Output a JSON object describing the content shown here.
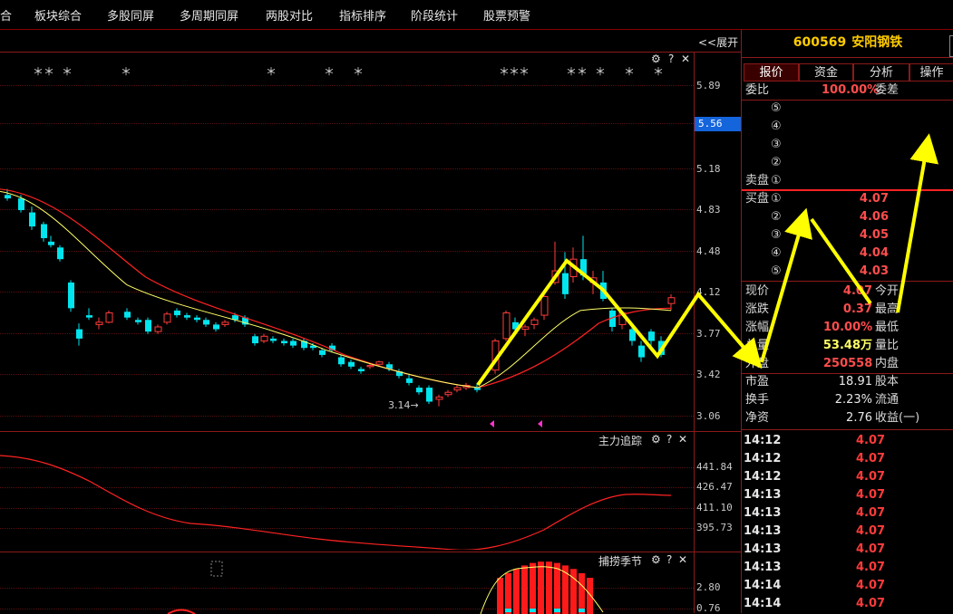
{
  "menu": {
    "items": [
      "合",
      "板块综合",
      "多股同屏",
      "多周期同屏",
      "两股对比",
      "指标排序",
      "阶段统计",
      "股票预警"
    ]
  },
  "chart": {
    "expand_label": "<<展开",
    "price_axis": [
      "5.89",
      "5.56",
      "5.18",
      "4.83",
      "4.48",
      "4.12",
      "3.77",
      "3.42",
      "3.06"
    ],
    "current_price_tag": "5.56",
    "low_annotation": "3.14",
    "gear_icon": "⚙",
    "help_icon": "?",
    "close_icon": "✕",
    "star_glyph": "＊",
    "indicator1": {
      "title": "主力追踪",
      "axis": [
        "441.84",
        "426.47",
        "411.10",
        "395.73"
      ]
    },
    "indicator2": {
      "title": "捕捞季节",
      "axis": [
        "2.80",
        "0.76"
      ]
    },
    "colors": {
      "up": "#ff3b3b",
      "down": "#00e5ee",
      "ma_yellow": "#ffff66",
      "ma_red": "#ff2222",
      "arrow": "#ffff00",
      "price_tag_bg": "#1464dc"
    }
  },
  "quote": {
    "code": "600569",
    "name": "安阳钢铁",
    "tabs": [
      "报价",
      "资金",
      "分析",
      "操作"
    ],
    "weibi_label": "委比",
    "weibi_value": "100.00%",
    "weicha_label": "委差",
    "sell_levels": [
      "⑤",
      "④",
      "③",
      "②",
      "①"
    ],
    "sell_label": "卖盘",
    "buy_label": "买盘",
    "buy_levels": [
      {
        "level": "①",
        "price": "4.07"
      },
      {
        "level": "②",
        "price": "4.06"
      },
      {
        "level": "③",
        "price": "4.05"
      },
      {
        "level": "④",
        "price": "4.04"
      },
      {
        "level": "⑤",
        "price": "4.03"
      }
    ],
    "stats": [
      {
        "l1": "现价",
        "v1": "4.07",
        "l2": "今开"
      },
      {
        "l1": "涨跌",
        "v1": "0.37",
        "l2": "最高"
      },
      {
        "l1": "涨幅",
        "v1": "10.00%",
        "l2": "最低"
      },
      {
        "l1": "总量",
        "v1": "53.48万",
        "l2": "量比"
      },
      {
        "l1": "外盘",
        "v1": "250558",
        "l2": "内盘"
      }
    ],
    "fundamentals": [
      {
        "l1": "市盈",
        "v1": "18.91",
        "l2": "股本"
      },
      {
        "l1": "换手",
        "v1": "2.23%",
        "l2": "流通"
      },
      {
        "l1": "净资",
        "v1": "2.76",
        "l2": "收益(一)"
      }
    ],
    "ticks": [
      {
        "time": "14:12",
        "price": "4.07"
      },
      {
        "time": "14:12",
        "price": "4.07"
      },
      {
        "time": "14:12",
        "price": "4.07"
      },
      {
        "time": "14:13",
        "price": "4.07"
      },
      {
        "time": "14:13",
        "price": "4.07"
      },
      {
        "time": "14:13",
        "price": "4.07"
      },
      {
        "time": "14:13",
        "price": "4.07"
      },
      {
        "time": "14:13",
        "price": "4.07"
      },
      {
        "time": "14:14",
        "price": "4.07"
      },
      {
        "time": "14:14",
        "price": "4.07"
      }
    ]
  }
}
